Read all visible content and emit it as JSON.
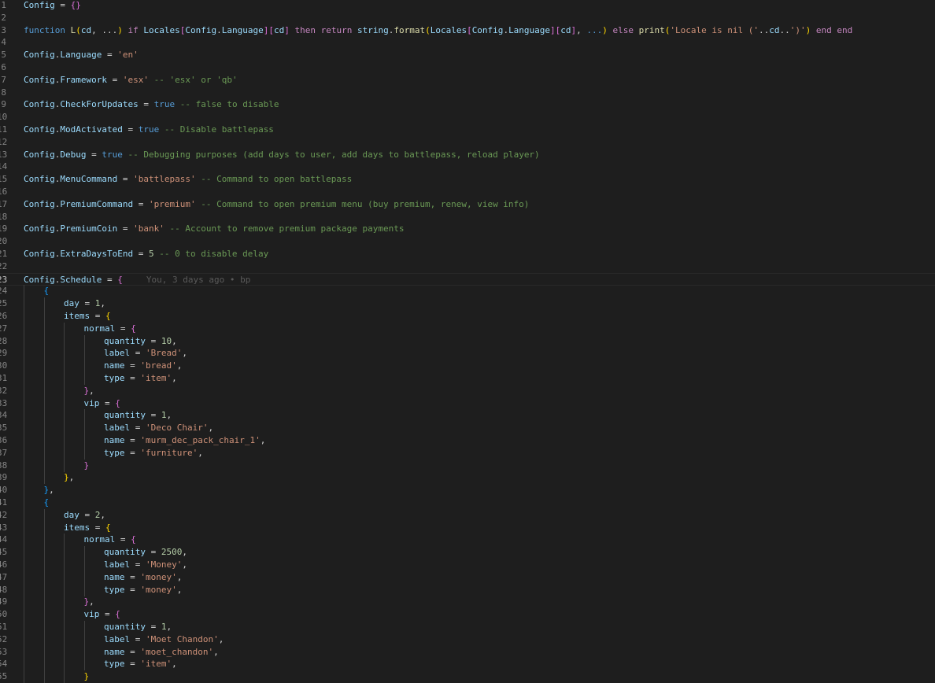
{
  "editor": {
    "current_line": 23,
    "blame": "You, 3 days ago • bp",
    "lines": [
      {
        "n": 1,
        "indent": 0,
        "tokens": [
          [
            "v",
            "Config"
          ],
          [
            "p",
            " = "
          ],
          [
            "b2",
            "{}"
          ]
        ]
      },
      {
        "n": 2,
        "indent": 0,
        "tokens": []
      },
      {
        "n": 3,
        "indent": 0,
        "tokens": [
          [
            "k",
            "function"
          ],
          [
            "p",
            " "
          ],
          [
            "f",
            "L"
          ],
          [
            "b1",
            "("
          ],
          [
            "v",
            "cd"
          ],
          [
            "p",
            ", ..."
          ],
          [
            "b1",
            ")"
          ],
          [
            "p",
            " "
          ],
          [
            "kw",
            "if"
          ],
          [
            "p",
            " "
          ],
          [
            "v",
            "Locales"
          ],
          [
            "b2",
            "["
          ],
          [
            "v",
            "Config"
          ],
          [
            "p",
            "."
          ],
          [
            "v",
            "Language"
          ],
          [
            "b2",
            "]"
          ],
          [
            "b2",
            "["
          ],
          [
            "v",
            "cd"
          ],
          [
            "b2",
            "]"
          ],
          [
            "p",
            " "
          ],
          [
            "kw",
            "then"
          ],
          [
            "p",
            " "
          ],
          [
            "kw",
            "return"
          ],
          [
            "p",
            " "
          ],
          [
            "v",
            "string"
          ],
          [
            "p",
            "."
          ],
          [
            "f",
            "format"
          ],
          [
            "b1",
            "("
          ],
          [
            "v",
            "Locales"
          ],
          [
            "b2",
            "["
          ],
          [
            "v",
            "Config"
          ],
          [
            "p",
            "."
          ],
          [
            "v",
            "Language"
          ],
          [
            "b2",
            "]"
          ],
          [
            "b2",
            "["
          ],
          [
            "v",
            "cd"
          ],
          [
            "b2",
            "]"
          ],
          [
            "p",
            ", "
          ],
          [
            "k",
            "..."
          ],
          [
            "b1",
            ")"
          ],
          [
            "p",
            " "
          ],
          [
            "kw",
            "else"
          ],
          [
            "p",
            " "
          ],
          [
            "f",
            "print"
          ],
          [
            "b1",
            "("
          ],
          [
            "s",
            "'Locale is nil ('"
          ],
          [
            "p",
            ".."
          ],
          [
            "v",
            "cd"
          ],
          [
            "p",
            ".."
          ],
          [
            "s",
            "')'"
          ],
          [
            "b1",
            ")"
          ],
          [
            "p",
            " "
          ],
          [
            "kw",
            "end"
          ],
          [
            "p",
            " "
          ],
          [
            "kw",
            "end"
          ]
        ]
      },
      {
        "n": 4,
        "indent": 0,
        "tokens": []
      },
      {
        "n": 5,
        "indent": 0,
        "tokens": [
          [
            "v",
            "Config"
          ],
          [
            "p",
            "."
          ],
          [
            "v",
            "Language"
          ],
          [
            "p",
            " = "
          ],
          [
            "s",
            "'en'"
          ]
        ]
      },
      {
        "n": 6,
        "indent": 0,
        "tokens": []
      },
      {
        "n": 7,
        "indent": 0,
        "tokens": [
          [
            "v",
            "Config"
          ],
          [
            "p",
            "."
          ],
          [
            "v",
            "Framework"
          ],
          [
            "p",
            " = "
          ],
          [
            "s",
            "'esx'"
          ],
          [
            "p",
            " "
          ],
          [
            "cm",
            "-- 'esx' or 'qb'"
          ]
        ]
      },
      {
        "n": 8,
        "indent": 0,
        "tokens": []
      },
      {
        "n": 9,
        "indent": 0,
        "tokens": [
          [
            "v",
            "Config"
          ],
          [
            "p",
            "."
          ],
          [
            "v",
            "CheckForUpdates"
          ],
          [
            "p",
            " = "
          ],
          [
            "k",
            "true"
          ],
          [
            "p",
            " "
          ],
          [
            "cm",
            "-- false to disable"
          ]
        ]
      },
      {
        "n": 10,
        "indent": 0,
        "tokens": []
      },
      {
        "n": 11,
        "indent": 0,
        "tokens": [
          [
            "v",
            "Config"
          ],
          [
            "p",
            "."
          ],
          [
            "v",
            "ModActivated"
          ],
          [
            "p",
            " = "
          ],
          [
            "k",
            "true"
          ],
          [
            "p",
            " "
          ],
          [
            "cm",
            "-- Disable battlepass"
          ]
        ]
      },
      {
        "n": 12,
        "indent": 0,
        "tokens": []
      },
      {
        "n": 13,
        "indent": 0,
        "tokens": [
          [
            "v",
            "Config"
          ],
          [
            "p",
            "."
          ],
          [
            "v",
            "Debug"
          ],
          [
            "p",
            " = "
          ],
          [
            "k",
            "true"
          ],
          [
            "p",
            " "
          ],
          [
            "cm",
            "-- Debugging purposes (add days to user, add days to battlepass, reload player)"
          ]
        ]
      },
      {
        "n": 14,
        "indent": 0,
        "tokens": []
      },
      {
        "n": 15,
        "indent": 0,
        "tokens": [
          [
            "v",
            "Config"
          ],
          [
            "p",
            "."
          ],
          [
            "v",
            "MenuCommand"
          ],
          [
            "p",
            " = "
          ],
          [
            "s",
            "'battlepass'"
          ],
          [
            "p",
            " "
          ],
          [
            "cm",
            "-- Command to open battlepass"
          ]
        ]
      },
      {
        "n": 16,
        "indent": 0,
        "tokens": []
      },
      {
        "n": 17,
        "indent": 0,
        "tokens": [
          [
            "v",
            "Config"
          ],
          [
            "p",
            "."
          ],
          [
            "v",
            "PremiumCommand"
          ],
          [
            "p",
            " = "
          ],
          [
            "s",
            "'premium'"
          ],
          [
            "p",
            " "
          ],
          [
            "cm",
            "-- Command to open premium menu (buy premium, renew, view info)"
          ]
        ]
      },
      {
        "n": 18,
        "indent": 0,
        "tokens": []
      },
      {
        "n": 19,
        "indent": 0,
        "tokens": [
          [
            "v",
            "Config"
          ],
          [
            "p",
            "."
          ],
          [
            "v",
            "PremiumCoin"
          ],
          [
            "p",
            " = "
          ],
          [
            "s",
            "'bank'"
          ],
          [
            "p",
            " "
          ],
          [
            "cm",
            "-- Account to remove premium package payments"
          ]
        ]
      },
      {
        "n": 20,
        "indent": 0,
        "tokens": []
      },
      {
        "n": 21,
        "indent": 0,
        "tokens": [
          [
            "v",
            "Config"
          ],
          [
            "p",
            "."
          ],
          [
            "v",
            "ExtraDaysToEnd"
          ],
          [
            "p",
            " = "
          ],
          [
            "n",
            "5"
          ],
          [
            "p",
            " "
          ],
          [
            "cm",
            "-- 0 to disable delay"
          ]
        ]
      },
      {
        "n": 22,
        "indent": 0,
        "tokens": []
      },
      {
        "n": 23,
        "indent": 0,
        "tokens": [
          [
            "v",
            "Config"
          ],
          [
            "p",
            "."
          ],
          [
            "v",
            "Schedule"
          ],
          [
            "p",
            " = "
          ],
          [
            "b2",
            "{"
          ]
        ]
      },
      {
        "n": 24,
        "indent": 1,
        "tokens": [
          [
            "b3",
            "{"
          ]
        ]
      },
      {
        "n": 25,
        "indent": 2,
        "tokens": [
          [
            "v",
            "day"
          ],
          [
            "p",
            " = "
          ],
          [
            "n",
            "1"
          ],
          [
            "p",
            ","
          ]
        ]
      },
      {
        "n": 26,
        "indent": 2,
        "tokens": [
          [
            "v",
            "items"
          ],
          [
            "p",
            " = "
          ],
          [
            "b1",
            "{"
          ]
        ]
      },
      {
        "n": 27,
        "indent": 3,
        "tokens": [
          [
            "v",
            "normal"
          ],
          [
            "p",
            " = "
          ],
          [
            "b2",
            "{"
          ]
        ]
      },
      {
        "n": 28,
        "indent": 4,
        "tokens": [
          [
            "v",
            "quantity"
          ],
          [
            "p",
            " = "
          ],
          [
            "n",
            "10"
          ],
          [
            "p",
            ","
          ]
        ]
      },
      {
        "n": 29,
        "indent": 4,
        "tokens": [
          [
            "v",
            "label"
          ],
          [
            "p",
            " = "
          ],
          [
            "s",
            "'Bread'"
          ],
          [
            "p",
            ","
          ]
        ]
      },
      {
        "n": 30,
        "indent": 4,
        "tokens": [
          [
            "v",
            "name"
          ],
          [
            "p",
            " = "
          ],
          [
            "s",
            "'bread'"
          ],
          [
            "p",
            ","
          ]
        ]
      },
      {
        "n": 31,
        "indent": 4,
        "tokens": [
          [
            "v",
            "type"
          ],
          [
            "p",
            " = "
          ],
          [
            "s",
            "'item'"
          ],
          [
            "p",
            ","
          ]
        ]
      },
      {
        "n": 32,
        "indent": 3,
        "tokens": [
          [
            "b2",
            "}"
          ],
          [
            "p",
            ","
          ]
        ]
      },
      {
        "n": 33,
        "indent": 3,
        "tokens": [
          [
            "v",
            "vip"
          ],
          [
            "p",
            " = "
          ],
          [
            "b2",
            "{"
          ]
        ]
      },
      {
        "n": 34,
        "indent": 4,
        "tokens": [
          [
            "v",
            "quantity"
          ],
          [
            "p",
            " = "
          ],
          [
            "n",
            "1"
          ],
          [
            "p",
            ","
          ]
        ]
      },
      {
        "n": 35,
        "indent": 4,
        "tokens": [
          [
            "v",
            "label"
          ],
          [
            "p",
            " = "
          ],
          [
            "s",
            "'Deco Chair'"
          ],
          [
            "p",
            ","
          ]
        ]
      },
      {
        "n": 36,
        "indent": 4,
        "tokens": [
          [
            "v",
            "name"
          ],
          [
            "p",
            " = "
          ],
          [
            "s",
            "'murm_dec_pack_chair_1'"
          ],
          [
            "p",
            ","
          ]
        ]
      },
      {
        "n": 37,
        "indent": 4,
        "tokens": [
          [
            "v",
            "type"
          ],
          [
            "p",
            " = "
          ],
          [
            "s",
            "'furniture'"
          ],
          [
            "p",
            ","
          ]
        ]
      },
      {
        "n": 38,
        "indent": 3,
        "tokens": [
          [
            "b2",
            "}"
          ]
        ]
      },
      {
        "n": 39,
        "indent": 2,
        "tokens": [
          [
            "b1",
            "}"
          ],
          [
            "p",
            ","
          ]
        ]
      },
      {
        "n": 40,
        "indent": 1,
        "tokens": [
          [
            "b3",
            "}"
          ],
          [
            "p",
            ","
          ]
        ]
      },
      {
        "n": 41,
        "indent": 1,
        "tokens": [
          [
            "b3",
            "{"
          ]
        ]
      },
      {
        "n": 42,
        "indent": 2,
        "tokens": [
          [
            "v",
            "day"
          ],
          [
            "p",
            " = "
          ],
          [
            "n",
            "2"
          ],
          [
            "p",
            ","
          ]
        ]
      },
      {
        "n": 43,
        "indent": 2,
        "tokens": [
          [
            "v",
            "items"
          ],
          [
            "p",
            " = "
          ],
          [
            "b1",
            "{"
          ]
        ]
      },
      {
        "n": 44,
        "indent": 3,
        "tokens": [
          [
            "v",
            "normal"
          ],
          [
            "p",
            " = "
          ],
          [
            "b2",
            "{"
          ]
        ]
      },
      {
        "n": 45,
        "indent": 4,
        "tokens": [
          [
            "v",
            "quantity"
          ],
          [
            "p",
            " = "
          ],
          [
            "n",
            "2500"
          ],
          [
            "p",
            ","
          ]
        ]
      },
      {
        "n": 46,
        "indent": 4,
        "tokens": [
          [
            "v",
            "label"
          ],
          [
            "p",
            " = "
          ],
          [
            "s",
            "'Money'"
          ],
          [
            "p",
            ","
          ]
        ]
      },
      {
        "n": 47,
        "indent": 4,
        "tokens": [
          [
            "v",
            "name"
          ],
          [
            "p",
            " = "
          ],
          [
            "s",
            "'money'"
          ],
          [
            "p",
            ","
          ]
        ]
      },
      {
        "n": 48,
        "indent": 4,
        "tokens": [
          [
            "v",
            "type"
          ],
          [
            "p",
            " = "
          ],
          [
            "s",
            "'money'"
          ],
          [
            "p",
            ","
          ]
        ]
      },
      {
        "n": 49,
        "indent": 3,
        "tokens": [
          [
            "b2",
            "}"
          ],
          [
            "p",
            ","
          ]
        ]
      },
      {
        "n": 50,
        "indent": 3,
        "tokens": [
          [
            "v",
            "vip"
          ],
          [
            "p",
            " = "
          ],
          [
            "b2",
            "{"
          ]
        ]
      },
      {
        "n": 51,
        "indent": 4,
        "tokens": [
          [
            "v",
            "quantity"
          ],
          [
            "p",
            " = "
          ],
          [
            "n",
            "1"
          ],
          [
            "p",
            ","
          ]
        ]
      },
      {
        "n": 52,
        "indent": 4,
        "tokens": [
          [
            "v",
            "label"
          ],
          [
            "p",
            " = "
          ],
          [
            "s",
            "'Moet Chandon'"
          ],
          [
            "p",
            ","
          ]
        ]
      },
      {
        "n": 53,
        "indent": 4,
        "tokens": [
          [
            "v",
            "name"
          ],
          [
            "p",
            " = "
          ],
          [
            "s",
            "'moet_chandon'"
          ],
          [
            "p",
            ","
          ]
        ]
      },
      {
        "n": 54,
        "indent": 4,
        "tokens": [
          [
            "v",
            "type"
          ],
          [
            "p",
            " = "
          ],
          [
            "s",
            "'item'"
          ],
          [
            "p",
            ","
          ]
        ]
      },
      {
        "n": 55,
        "indent": 3,
        "tokens": [
          [
            "b1",
            "}"
          ]
        ]
      }
    ]
  },
  "colors": {
    "background": "#1e1e1e",
    "variable": "#9cdcfe",
    "keyword": "#569cd6",
    "control": "#c586c0",
    "string": "#ce9178",
    "number": "#b5cea8",
    "comment": "#6a9955",
    "function": "#dcdcaa"
  }
}
